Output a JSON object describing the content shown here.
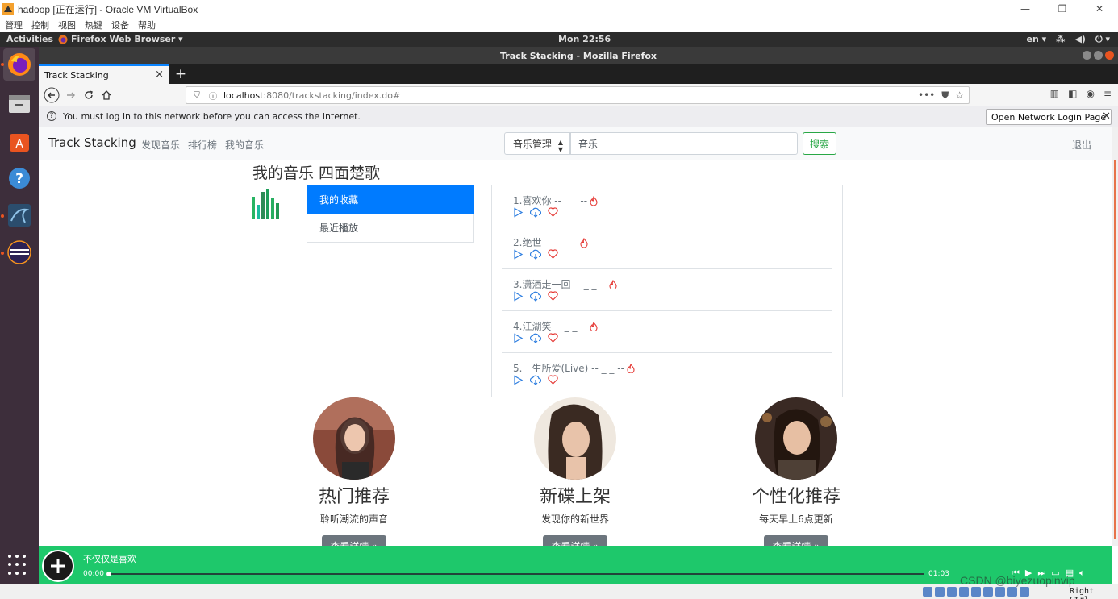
{
  "vbox": {
    "title": "hadoop [正在运行] - Oracle VM VirtualBox",
    "menu": [
      "管理",
      "控制",
      "视图",
      "热键",
      "设备",
      "帮助"
    ],
    "host_key": "Right Ctrl"
  },
  "ubuntu": {
    "activities": "Activities",
    "app_menu": "Firefox Web Browser ▾",
    "clock": "Mon 22:56",
    "lang": "en ▾"
  },
  "firefox": {
    "window_title": "Track Stacking - Mozilla Firefox",
    "tab_title": "Track Stacking",
    "url_host": "localhost",
    "url_path": ":8080/trackstacking/index.do#",
    "notification": "You must log in to this network before you can access the Internet.",
    "notification_button": "Open Network Login Page"
  },
  "site": {
    "brand": "Track Stacking",
    "nav": [
      "发现音乐",
      "排行榜",
      "我的音乐"
    ],
    "search_select": "音乐管理",
    "search_value": "音乐",
    "search_button": "搜索",
    "logout": "退出",
    "page_title": "我的音乐 四面楚歌",
    "side_menu": [
      {
        "label": "我的收藏",
        "active": true
      },
      {
        "label": "最近播放",
        "active": false
      }
    ],
    "songs": [
      "1.喜欢你 -- _ _ --",
      "2.绝世 -- _ _ --",
      "3.潇洒走一回 -- _ _ --",
      "4.江湖笑 -- _ _ --",
      "5.一生所爱(Live) -- _ _ --"
    ],
    "promos": [
      {
        "title": "热门推荐",
        "subtitle": "聆听潮流的声音",
        "button": "查看详情 »"
      },
      {
        "title": "新碟上架",
        "subtitle": "发现你的新世界",
        "button": "查看详情 »"
      },
      {
        "title": "个性化推荐",
        "subtitle": "每天早上6点更新",
        "button": "查看详情 »"
      }
    ]
  },
  "player": {
    "song": "不仅仅是喜欢",
    "current_time": "00:00",
    "duration": "01:03",
    "progress": 0
  },
  "watermark": "CSDN @biyezuopinvip",
  "colors": {
    "player_green": "#1ec86b",
    "primary_blue": "#007bff",
    "success_green": "#28a745",
    "icon_blue": "#2f7fe0",
    "heart_red": "#e53935"
  }
}
